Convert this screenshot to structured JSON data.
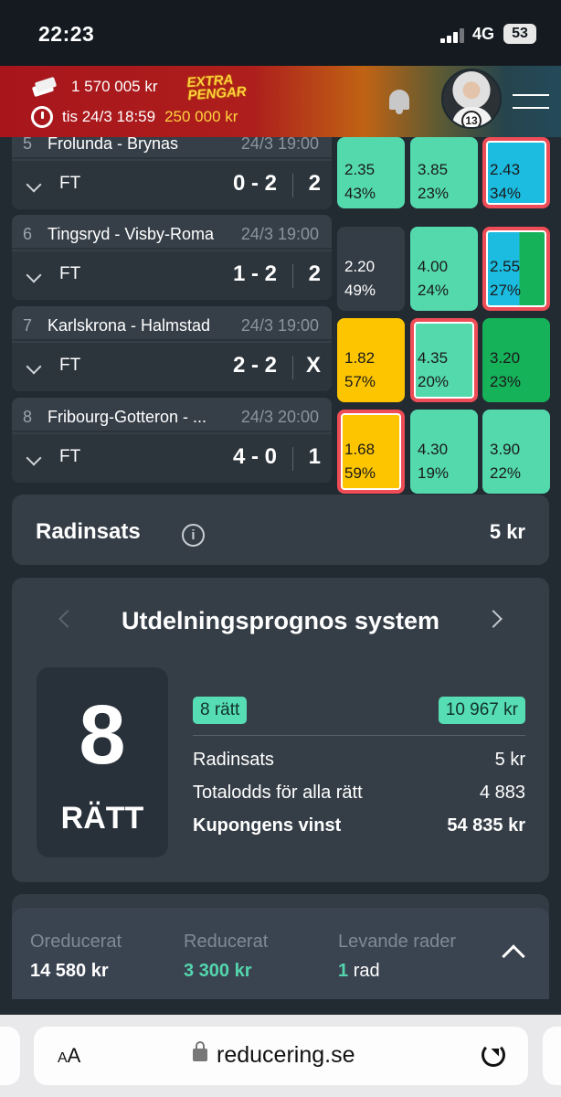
{
  "status_bar": {
    "time": "22:23",
    "network": "4G",
    "battery": "53"
  },
  "header": {
    "balance": "1 570 005 kr",
    "deadline": "tis 24/3 18:59",
    "extra_logo_line1": "EXTRA",
    "extra_logo_line2": "PENGAR",
    "extra_amount": "250 000 kr",
    "avatar_number": "13"
  },
  "matches": [
    {
      "num": "5",
      "teams": "Frolunda - Brynas",
      "datetime": "24/3 19:00",
      "status": "FT",
      "score": "0 - 2",
      "result": "2",
      "odds": [
        {
          "odd": "2.35",
          "pct": "43%",
          "color": "#54d9ad",
          "selected": false
        },
        {
          "odd": "3.85",
          "pct": "23%",
          "color": "#54d9ad",
          "selected": false
        },
        {
          "odd": "2.43",
          "pct": "34%",
          "color": "#1cbce0",
          "selected": true
        }
      ]
    },
    {
      "num": "6",
      "teams": "Tingsryd - Visby-Roma",
      "datetime": "24/3 19:00",
      "status": "FT",
      "score": "1 - 2",
      "result": "2",
      "odds": [
        {
          "odd": "2.20",
          "pct": "49%",
          "color": "#343d46",
          "selected": false
        },
        {
          "odd": "4.00",
          "pct": "24%",
          "color": "#54d9ad",
          "selected": false
        },
        {
          "odd": "2.55",
          "pct": "27%",
          "color": "#1cbce0",
          "selected": true
        }
      ]
    },
    {
      "num": "7",
      "teams": "Karlskrona - Halmstad",
      "datetime": "24/3 19:00",
      "status": "FT",
      "score": "2 - 2",
      "result": "X",
      "odds": [
        {
          "odd": "1.82",
          "pct": "57%",
          "color": "#fdc500",
          "selected": false
        },
        {
          "odd": "4.35",
          "pct": "20%",
          "color": "#54d9ad",
          "selected": true
        },
        {
          "odd": "3.20",
          "pct": "23%",
          "color": "#16b25a",
          "selected": false
        }
      ]
    },
    {
      "num": "8",
      "teams": "Fribourg-Gotteron - ...",
      "datetime": "24/3 20:00",
      "status": "FT",
      "score": "4 - 0",
      "result": "1",
      "odds": [
        {
          "odd": "1.68",
          "pct": "59%",
          "color": "#fdc500",
          "selected": true
        },
        {
          "odd": "4.30",
          "pct": "19%",
          "color": "#54d9ad",
          "selected": false
        },
        {
          "odd": "3.90",
          "pct": "22%",
          "color": "#54d9ad",
          "selected": false
        }
      ]
    }
  ],
  "radinsats": {
    "label": "Radinsats",
    "value": "5 kr"
  },
  "prognos": {
    "title": "Utdelningsprognos system",
    "big_number": "8",
    "big_label": "RÄTT",
    "pill_left": "8 rätt",
    "pill_right": "10 967 kr",
    "rows": [
      {
        "label": "Radinsats",
        "value": "5 kr"
      },
      {
        "label": "Totalodds för alla rätt",
        "value": "4 883"
      },
      {
        "label": "Kupongens vinst",
        "value": "54 835 kr"
      }
    ]
  },
  "summary": {
    "oreducerat_label": "Oreducerat",
    "oreducerat_value": "14 580 kr",
    "reducerat_label": "Reducerat",
    "reducerat_value": "3 300 kr",
    "levande_label": "Levande rader",
    "levande_count": "1",
    "levande_unit": "rad"
  },
  "browser": {
    "aa_small": "A",
    "aa_big": "A",
    "domain": "reducering.se"
  },
  "colors": {
    "accent_teal": "#54d9ad",
    "selected_border": "#ee4c56",
    "header_red": "#a8161c",
    "gold": "#ffd23d"
  }
}
